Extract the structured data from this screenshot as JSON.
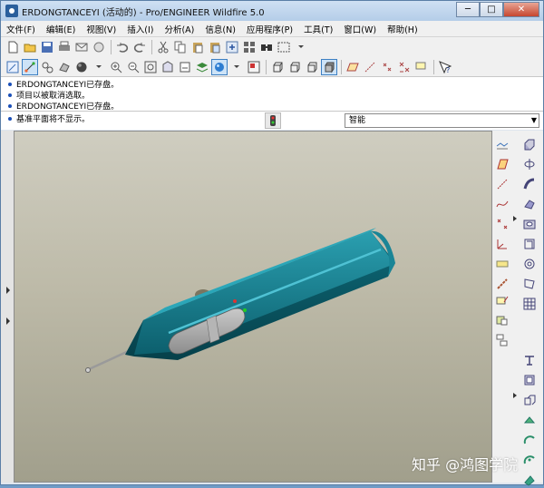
{
  "window": {
    "title": "ERDONGTANCEYI (活动的) - Pro/ENGINEER Wildfire 5.0",
    "minimize": "─",
    "maximize": "□",
    "close": "✕"
  },
  "menu": [
    "文件(F)",
    "编辑(E)",
    "视图(V)",
    "插入(I)",
    "分析(A)",
    "信息(N)",
    "应用程序(P)",
    "工具(T)",
    "窗口(W)",
    "帮助(H)"
  ],
  "messages": [
    "ERDONGTANCEYI已存盘。",
    "项目以被取消选取。",
    "ERDONGTANCEYI已存盘。",
    "基准平面将不显示。"
  ],
  "filter": {
    "value": "智能"
  },
  "watermark": "知乎 @鸿图学院",
  "colors": {
    "model": "#0f6b7c",
    "model_highlight": "#35aabd",
    "window_slot": "#9a9a9a",
    "viewport_top": "#cfcdc0",
    "viewport_bottom": "#a19f8c"
  }
}
